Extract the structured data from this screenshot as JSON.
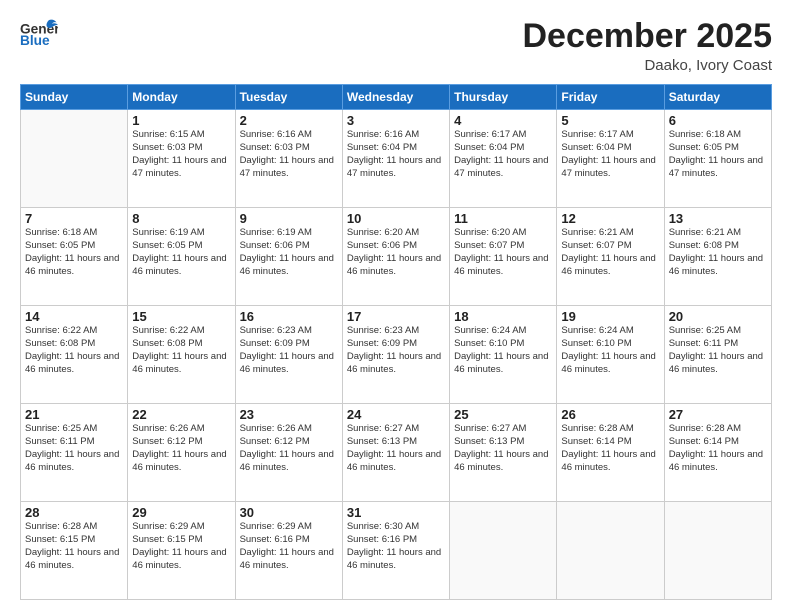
{
  "header": {
    "logo_general": "General",
    "logo_blue": "Blue",
    "month": "December 2025",
    "location": "Daako, Ivory Coast"
  },
  "weekdays": [
    "Sunday",
    "Monday",
    "Tuesday",
    "Wednesday",
    "Thursday",
    "Friday",
    "Saturday"
  ],
  "weeks": [
    [
      {
        "day": "",
        "sunrise": "",
        "sunset": "",
        "daylight": ""
      },
      {
        "day": "1",
        "sunrise": "Sunrise: 6:15 AM",
        "sunset": "Sunset: 6:03 PM",
        "daylight": "Daylight: 11 hours and 47 minutes."
      },
      {
        "day": "2",
        "sunrise": "Sunrise: 6:16 AM",
        "sunset": "Sunset: 6:03 PM",
        "daylight": "Daylight: 11 hours and 47 minutes."
      },
      {
        "day": "3",
        "sunrise": "Sunrise: 6:16 AM",
        "sunset": "Sunset: 6:04 PM",
        "daylight": "Daylight: 11 hours and 47 minutes."
      },
      {
        "day": "4",
        "sunrise": "Sunrise: 6:17 AM",
        "sunset": "Sunset: 6:04 PM",
        "daylight": "Daylight: 11 hours and 47 minutes."
      },
      {
        "day": "5",
        "sunrise": "Sunrise: 6:17 AM",
        "sunset": "Sunset: 6:04 PM",
        "daylight": "Daylight: 11 hours and 47 minutes."
      },
      {
        "day": "6",
        "sunrise": "Sunrise: 6:18 AM",
        "sunset": "Sunset: 6:05 PM",
        "daylight": "Daylight: 11 hours and 47 minutes."
      }
    ],
    [
      {
        "day": "7",
        "sunrise": "Sunrise: 6:18 AM",
        "sunset": "Sunset: 6:05 PM",
        "daylight": "Daylight: 11 hours and 46 minutes."
      },
      {
        "day": "8",
        "sunrise": "Sunrise: 6:19 AM",
        "sunset": "Sunset: 6:05 PM",
        "daylight": "Daylight: 11 hours and 46 minutes."
      },
      {
        "day": "9",
        "sunrise": "Sunrise: 6:19 AM",
        "sunset": "Sunset: 6:06 PM",
        "daylight": "Daylight: 11 hours and 46 minutes."
      },
      {
        "day": "10",
        "sunrise": "Sunrise: 6:20 AM",
        "sunset": "Sunset: 6:06 PM",
        "daylight": "Daylight: 11 hours and 46 minutes."
      },
      {
        "day": "11",
        "sunrise": "Sunrise: 6:20 AM",
        "sunset": "Sunset: 6:07 PM",
        "daylight": "Daylight: 11 hours and 46 minutes."
      },
      {
        "day": "12",
        "sunrise": "Sunrise: 6:21 AM",
        "sunset": "Sunset: 6:07 PM",
        "daylight": "Daylight: 11 hours and 46 minutes."
      },
      {
        "day": "13",
        "sunrise": "Sunrise: 6:21 AM",
        "sunset": "Sunset: 6:08 PM",
        "daylight": "Daylight: 11 hours and 46 minutes."
      }
    ],
    [
      {
        "day": "14",
        "sunrise": "Sunrise: 6:22 AM",
        "sunset": "Sunset: 6:08 PM",
        "daylight": "Daylight: 11 hours and 46 minutes."
      },
      {
        "day": "15",
        "sunrise": "Sunrise: 6:22 AM",
        "sunset": "Sunset: 6:08 PM",
        "daylight": "Daylight: 11 hours and 46 minutes."
      },
      {
        "day": "16",
        "sunrise": "Sunrise: 6:23 AM",
        "sunset": "Sunset: 6:09 PM",
        "daylight": "Daylight: 11 hours and 46 minutes."
      },
      {
        "day": "17",
        "sunrise": "Sunrise: 6:23 AM",
        "sunset": "Sunset: 6:09 PM",
        "daylight": "Daylight: 11 hours and 46 minutes."
      },
      {
        "day": "18",
        "sunrise": "Sunrise: 6:24 AM",
        "sunset": "Sunset: 6:10 PM",
        "daylight": "Daylight: 11 hours and 46 minutes."
      },
      {
        "day": "19",
        "sunrise": "Sunrise: 6:24 AM",
        "sunset": "Sunset: 6:10 PM",
        "daylight": "Daylight: 11 hours and 46 minutes."
      },
      {
        "day": "20",
        "sunrise": "Sunrise: 6:25 AM",
        "sunset": "Sunset: 6:11 PM",
        "daylight": "Daylight: 11 hours and 46 minutes."
      }
    ],
    [
      {
        "day": "21",
        "sunrise": "Sunrise: 6:25 AM",
        "sunset": "Sunset: 6:11 PM",
        "daylight": "Daylight: 11 hours and 46 minutes."
      },
      {
        "day": "22",
        "sunrise": "Sunrise: 6:26 AM",
        "sunset": "Sunset: 6:12 PM",
        "daylight": "Daylight: 11 hours and 46 minutes."
      },
      {
        "day": "23",
        "sunrise": "Sunrise: 6:26 AM",
        "sunset": "Sunset: 6:12 PM",
        "daylight": "Daylight: 11 hours and 46 minutes."
      },
      {
        "day": "24",
        "sunrise": "Sunrise: 6:27 AM",
        "sunset": "Sunset: 6:13 PM",
        "daylight": "Daylight: 11 hours and 46 minutes."
      },
      {
        "day": "25",
        "sunrise": "Sunrise: 6:27 AM",
        "sunset": "Sunset: 6:13 PM",
        "daylight": "Daylight: 11 hours and 46 minutes."
      },
      {
        "day": "26",
        "sunrise": "Sunrise: 6:28 AM",
        "sunset": "Sunset: 6:14 PM",
        "daylight": "Daylight: 11 hours and 46 minutes."
      },
      {
        "day": "27",
        "sunrise": "Sunrise: 6:28 AM",
        "sunset": "Sunset: 6:14 PM",
        "daylight": "Daylight: 11 hours and 46 minutes."
      }
    ],
    [
      {
        "day": "28",
        "sunrise": "Sunrise: 6:28 AM",
        "sunset": "Sunset: 6:15 PM",
        "daylight": "Daylight: 11 hours and 46 minutes."
      },
      {
        "day": "29",
        "sunrise": "Sunrise: 6:29 AM",
        "sunset": "Sunset: 6:15 PM",
        "daylight": "Daylight: 11 hours and 46 minutes."
      },
      {
        "day": "30",
        "sunrise": "Sunrise: 6:29 AM",
        "sunset": "Sunset: 6:16 PM",
        "daylight": "Daylight: 11 hours and 46 minutes."
      },
      {
        "day": "31",
        "sunrise": "Sunrise: 6:30 AM",
        "sunset": "Sunset: 6:16 PM",
        "daylight": "Daylight: 11 hours and 46 minutes."
      },
      {
        "day": "",
        "sunrise": "",
        "sunset": "",
        "daylight": ""
      },
      {
        "day": "",
        "sunrise": "",
        "sunset": "",
        "daylight": ""
      },
      {
        "day": "",
        "sunrise": "",
        "sunset": "",
        "daylight": ""
      }
    ]
  ]
}
